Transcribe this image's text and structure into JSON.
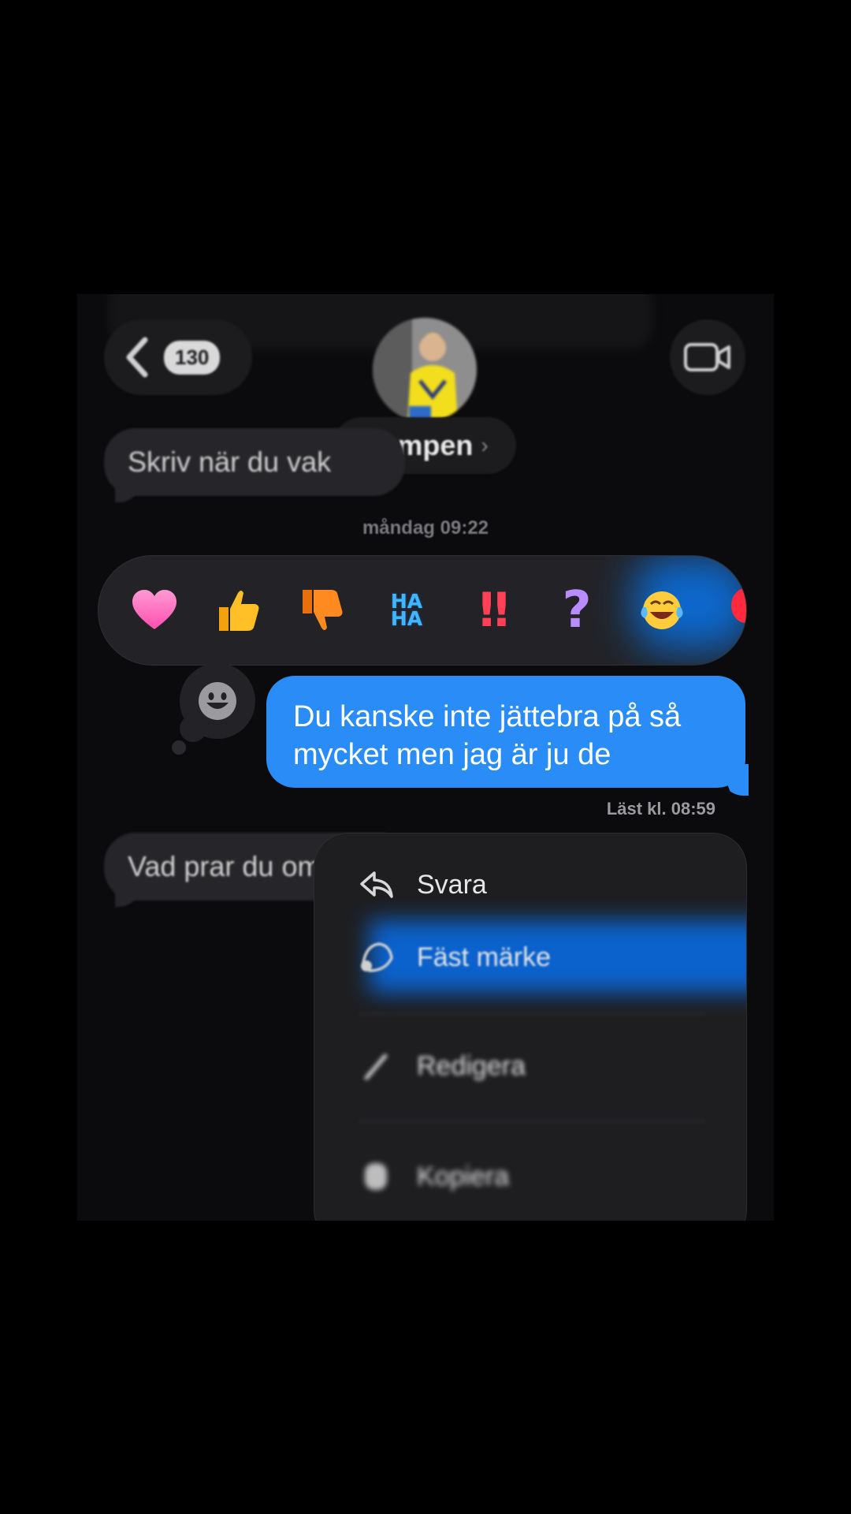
{
  "header": {
    "unread_count": "130",
    "contact_name": "Sumpen",
    "icons": {
      "back": "chevron-left-icon",
      "video": "video-camera-icon",
      "contact_chevron": "chevron-right-icon"
    }
  },
  "messages": {
    "incoming_top": "Skriv när du vak",
    "timestamp": "måndag 09:22",
    "outgoing": "Du kanske inte jättebra på så mycket men jag är ju de",
    "read_receipt": "Läst kl. 08:59",
    "incoming_bottom": "Vad prar du om"
  },
  "reactions": [
    {
      "name": "heart",
      "glyph": "heart-icon",
      "color": "#ff6fc3"
    },
    {
      "name": "thumbs-up",
      "glyph": "thumbs-up-icon",
      "color": "#ffb516"
    },
    {
      "name": "thumbs-down",
      "glyph": "thumbs-down-icon",
      "color": "#ff8a1f"
    },
    {
      "name": "haha",
      "text": "HA HA",
      "color": "#3fb6ff"
    },
    {
      "name": "exclamation",
      "text": "‼",
      "color": "#ff4057"
    },
    {
      "name": "question",
      "text": "?",
      "color": "#b98cff"
    },
    {
      "name": "laughing",
      "glyph": "tears-of-joy-icon",
      "color": "#ffcd3c"
    },
    {
      "name": "balloon",
      "glyph": "balloon-icon",
      "color": "#ff2a3d"
    }
  ],
  "menu": {
    "items": [
      {
        "label": "Svara",
        "icon": "reply-icon"
      },
      {
        "label": "Fäst märke",
        "icon": "sticker-icon"
      },
      {
        "label": "Redigera",
        "icon": "pencil-icon"
      },
      {
        "label": "Kopiera",
        "icon": "copy-icon"
      }
    ],
    "highlight_color": "#0a66d6"
  },
  "colors": {
    "outgoing_bubble": "#2a8df7",
    "incoming_bubble": "#26262a",
    "background": "#0b0b0d"
  }
}
